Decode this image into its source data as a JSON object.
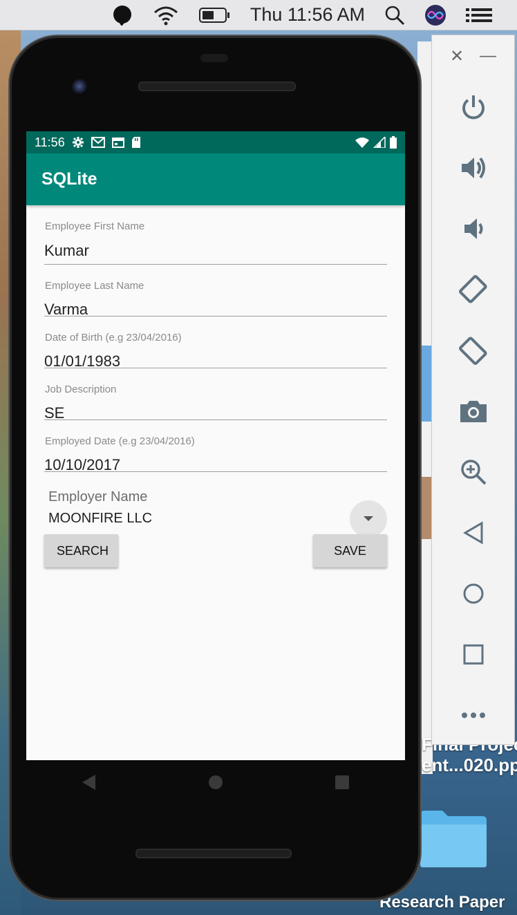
{
  "menubar": {
    "clock": "Thu 11:56 AM",
    "icons": [
      "chat-bubble-icon",
      "wifi-icon",
      "battery-icon",
      "spotlight-search-icon",
      "siri-icon",
      "control-center-icon"
    ]
  },
  "desktop": {
    "file_label_line1": "Final Projec",
    "file_label_line2": "ent...020.pp",
    "folder_label": "Research Paper"
  },
  "phone": {
    "statusbar": {
      "time": "11:56",
      "left_icons": [
        "settings-icon",
        "gmail-icon",
        "calendar-icon",
        "sd-card-icon"
      ],
      "right_icons": [
        "wifi-icon",
        "signal-icon",
        "battery-icon"
      ]
    },
    "appbar": {
      "title": "SQLite"
    },
    "form": {
      "fields": [
        {
          "label": "Employee First Name",
          "value": "Kumar"
        },
        {
          "label": "Employee Last Name",
          "value": "Varma"
        },
        {
          "label": "Date of Birth (e.g 23/04/2016)",
          "value": "01/01/1983"
        },
        {
          "label": "Job Description",
          "value": "SE"
        },
        {
          "label": "Employed Date (e.g 23/04/2016)",
          "value": "10/10/2017"
        }
      ],
      "employer": {
        "label": "Employer Name",
        "selected": "MOONFIRE LLC"
      },
      "buttons": {
        "search": "SEARCH",
        "save": "SAVE"
      }
    },
    "navbar": [
      "back-icon",
      "home-icon",
      "recents-icon"
    ]
  },
  "emulator_panel": {
    "controls": [
      "power-icon",
      "volume-up-icon",
      "volume-down-icon",
      "rotate-left-icon",
      "rotate-right-icon",
      "camera-icon",
      "zoom-icon",
      "back-icon",
      "home-icon",
      "overview-icon",
      "more-icon"
    ],
    "accent": "#5f7280"
  }
}
